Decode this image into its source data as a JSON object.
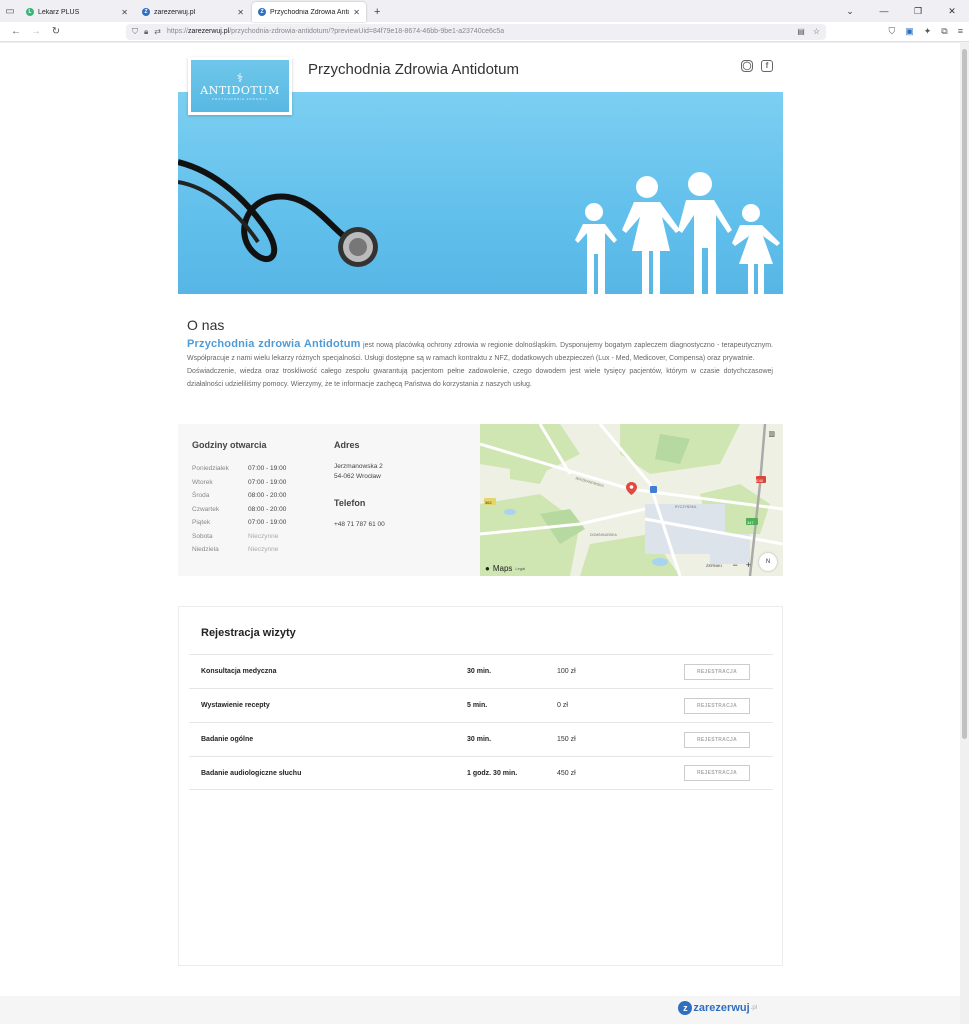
{
  "browser": {
    "tabs": [
      {
        "label": "Lekarz PLUS",
        "color": "#3bb37a",
        "icon_letter": "L"
      },
      {
        "label": "zarezerwuj.pl",
        "color": "#2f6fc0",
        "icon_letter": "Z"
      },
      {
        "label": "Przychodnia Zdrowia Antidotum",
        "color": "#2f6fc0",
        "icon_letter": "Z"
      }
    ],
    "url_prefix": "https://",
    "url_host": "zarezerwuj.pl",
    "url_path": "/przychodnia-zdrowia-antidotum/?previewUid=84f79e18-8674-46bb-9be1-a23740ce6c5a"
  },
  "header": {
    "logo_name": "ANTIDOTUM",
    "logo_sub": "PRZYCHODNIA ZDROWIA",
    "title": "Przychodnia Zdrowia Antidotum"
  },
  "about": {
    "heading": "O nas",
    "brand": "Przychodnia zdrowia Antidotum",
    "p1": " jest nową placówką ochrony zdrowia w regionie dolnośląskim. Dysponujemy bogatym zapleczem diagnostyczno - terapeutycznym. Współpracuje z nami wielu lekarzy różnych specjalności. Usługi dostępne są w ramach kontraktu z NFZ, dodatkowych ubezpieczeń (Lux - Med, Medicover, Compensa) oraz prywatnie.",
    "p2": "Doświadczenie, wiedza oraz troskliwość całego zespołu gwarantują pacjentom pełne zadowolenie, czego dowodem jest wiele tysięcy pacjentów, którym w czasie dotychczasowej działalności udzieliliśmy pomocy. Wierzymy, że te informacje zachęcą Państwa do korzystania z naszych usług."
  },
  "hours": {
    "heading": "Godziny otwarcia",
    "rows": [
      {
        "day": "Poniedziałek",
        "time": "07:00 - 19:00"
      },
      {
        "day": "Wtorek",
        "time": "07:00 - 19:00"
      },
      {
        "day": "Środa",
        "time": "08:00 - 20:00"
      },
      {
        "day": "Czwartek",
        "time": "08:00 - 20:00"
      },
      {
        "day": "Piątek",
        "time": "07:00 - 19:00"
      },
      {
        "day": "Sobota",
        "time": "Nieczynne"
      },
      {
        "day": "Niedziela",
        "time": "Nieczynne"
      }
    ]
  },
  "address": {
    "heading": "Adres",
    "street": "Jerzmanowska 2",
    "city": "54-062 Wrocław",
    "phone_heading": "Telefon",
    "phone": "+48 71 787 61 00"
  },
  "map": {
    "attribution": "Maps",
    "legal": "Legal",
    "place_label": "ŻERNIKI",
    "road_badges": [
      "362",
      "E40",
      "347"
    ],
    "street_labels": [
      "JERZMANOWSKA",
      "RYCZYŃSKA",
      "DOMINIKAŃSKA"
    ]
  },
  "registration": {
    "heading": "Rejestracja wizyty",
    "button_label": "REJESTRACJA",
    "services": [
      {
        "name": "Konsultacja medyczna",
        "duration": "30 min.",
        "price": "100 zł"
      },
      {
        "name": "Wystawienie recepty",
        "duration": "5 min.",
        "price": "0 zł"
      },
      {
        "name": "Badanie ogólne",
        "duration": "30 min.",
        "price": "150 zł"
      },
      {
        "name": "Badanie audiologiczne słuchu",
        "duration": "1 godz. 30 min.",
        "price": "450 zł"
      }
    ]
  },
  "footer": {
    "brand": "zarezerwuj",
    "tld": ".pl"
  }
}
